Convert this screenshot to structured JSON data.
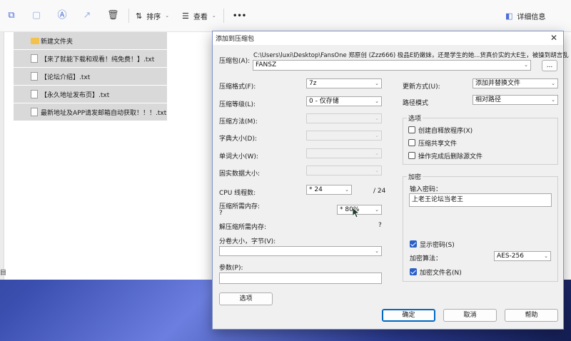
{
  "explorer": {
    "toolbar": {
      "sort_label": "排序",
      "view_label": "查看",
      "more_label": "•••",
      "details_label": "详细信息"
    },
    "files": [
      {
        "name": "新建文件夹",
        "type": "folder"
      },
      {
        "name": "【来了就能下载和观看！纯免费！】.txt",
        "type": "file"
      },
      {
        "name": "【论坛介绍】.txt",
        "type": "file"
      },
      {
        "name": "【永久地址发布页】.txt",
        "type": "file"
      },
      {
        "name": "最新地址及APP请发邮箱自动获取！！！.txt",
        "type": "file"
      }
    ],
    "status_text": "目"
  },
  "dialog": {
    "title": "添加到压缩包",
    "archive": {
      "label": "压缩包(A):",
      "path_text": "C:\\Users\\luxi\\Desktop\\FansOne 郑原创 (Zzz666) 极品E奶嫩妹，还是学生的她...货真价实的大E生，被操到胡言乱",
      "name_value": "FANSZ",
      "browse_label": "..."
    },
    "left": {
      "format_label": "压缩格式(F):",
      "format_value": "7z",
      "level_label": "压缩等级(L):",
      "level_value": "0 - 仅存储",
      "method_label": "压缩方法(M):",
      "dict_label": "字典大小(D):",
      "word_label": "单词大小(W):",
      "solid_label": "固实数据大小:",
      "cpu_label": "CPU 线程数:",
      "cpu_value": "* 24",
      "cpu_max": "/ 24",
      "mem_label": "压缩所需内存:",
      "mem_q": "?",
      "mem_value": "* 80%",
      "decomp_label": "解压缩所需内存:",
      "decomp_q": "?",
      "split_label": "分卷大小，字节(V):",
      "split_value": "",
      "params_label": "参数(P):",
      "params_value": "",
      "options_button": "选项"
    },
    "right": {
      "update_label": "更新方式(U):",
      "update_value": "添加并替换文件",
      "path_label": "路径模式",
      "path_value": "相对路径",
      "options_group": "选项",
      "opt_sfx": "创建自释放程序(X)",
      "opt_shared": "压缩共享文件",
      "opt_delete": "操作完成后删除源文件",
      "encrypt_group": "加密",
      "password_label": "输入密码：",
      "password_value": "上老王论坛当老王",
      "show_password": "显示密码(S)",
      "algo_label": "加密算法：",
      "algo_value": "AES-256",
      "encrypt_names": "加密文件名(N)"
    },
    "buttons": {
      "ok": "确定",
      "cancel": "取消",
      "help": "帮助"
    },
    "colors": {
      "accent": "#0067c0",
      "checkbox": "#2a5fc7"
    }
  }
}
